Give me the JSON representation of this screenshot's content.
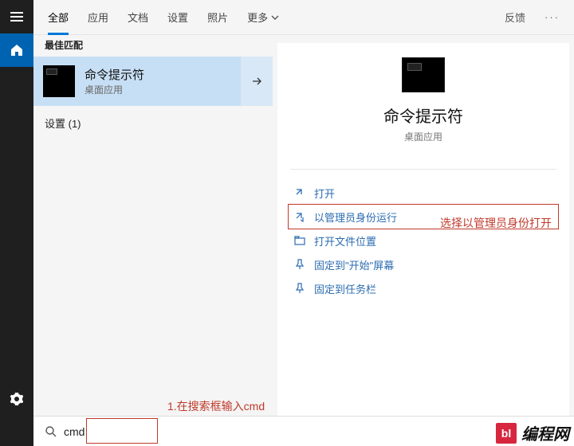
{
  "rail": {
    "menu_icon": "menu",
    "home_icon": "home",
    "settings_icon": "gear"
  },
  "tabs": {
    "items": [
      "全部",
      "应用",
      "文档",
      "设置",
      "照片"
    ],
    "more_label": "更多",
    "feedback_label": "反馈"
  },
  "results": {
    "section_label": "最佳匹配",
    "best": {
      "title": "命令提示符",
      "subtitle": "桌面应用"
    },
    "settings_label": "设置 (1)"
  },
  "preview": {
    "title": "命令提示符",
    "subtitle": "桌面应用"
  },
  "actions": {
    "open": "打开",
    "run_admin": "以管理员身份运行",
    "open_location": "打开文件位置",
    "pin_start": "固定到\"开始\"屏幕",
    "pin_taskbar": "固定到任务栏"
  },
  "annotations": {
    "step1": "1.在搜索框输入cmd",
    "step2": "选择以管理员身份打开"
  },
  "search": {
    "value": "cmd",
    "placeholder": ""
  },
  "watermark": {
    "badge": "bl",
    "text": "编程网"
  }
}
